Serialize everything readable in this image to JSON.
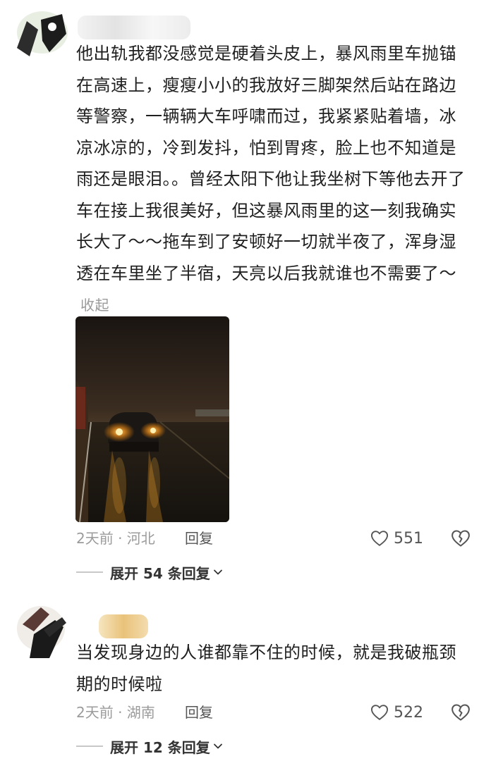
{
  "comments": [
    {
      "text": "他出轨我都没感觉是硬着头皮上，暴风雨里车抛锚在高速上，瘦瘦小小的我放好三脚架然后站在路边等警察，一辆辆大车呼啸而过，我紧紧贴着墙，冰凉冰凉的，冷到发抖，怕到胃疼，脸上也不知道是雨还是眼泪。。曾经太阳下他让我坐树下等他去开了车在接上我很美好，但这暴风雨里的这一刻我确实长大了～～拖车到了安顿好一切就半夜了，浑身湿透在车里坐了半宿，天亮以后我就谁也不需要了～",
      "collapse_label": "收起",
      "time_location": "2天前 · 河北",
      "reply_label": "回复",
      "likes": "551",
      "expand_label": "展开 54 条回复"
    },
    {
      "text": "当发现身边的人谁都靠不住的时候，就是我破瓶颈期的时候啦",
      "time_location": "2天前 · 湖南",
      "reply_label": "回复",
      "likes": "522",
      "expand_label": "展开 12 条回复"
    }
  ],
  "icons": {
    "like": "heart-outline-icon",
    "dislike": "broken-heart-icon",
    "expand": "chevron-down-icon"
  }
}
